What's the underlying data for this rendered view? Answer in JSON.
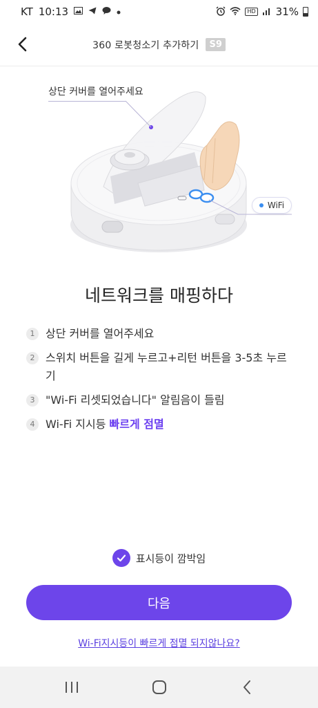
{
  "status_bar": {
    "carrier": "KT",
    "time": "10:13",
    "left_icons": [
      "gallery-icon",
      "telegram-icon",
      "kakao-icon",
      "dot-icon"
    ],
    "right_icons": [
      "alarm-icon",
      "wifi-icon",
      "hd-icon",
      "signal-icon"
    ],
    "hd_label": "HD",
    "battery": "31%"
  },
  "header": {
    "title": "360 로봇청소기 추가하기",
    "model_badge": "S9",
    "back_icon": "chevron-left-icon"
  },
  "illustration": {
    "callout": "상단 커버를 열어주세요",
    "wifi_label": "WiFi"
  },
  "main": {
    "title": "네트워크를 매핑하다",
    "steps": [
      {
        "num": "1",
        "text": "상단 커버를 열어주세요"
      },
      {
        "num": "2",
        "text": "스위치 버튼을 길게 누르고+리턴  버튼을 3-5초 누르기"
      },
      {
        "num": "3",
        "text": "\"Wi-Fi 리셋되었습니다\" 알림음이 들림"
      },
      {
        "num": "4",
        "text": "Wi-Fi 지시등 ",
        "highlight": "빠르게 점멸"
      }
    ]
  },
  "confirm": {
    "label": "표시등이 깜박임",
    "checked": true
  },
  "next_button": "다음",
  "help_link": "Wi-Fi지시등이 빠르게 점멸 되지않나요?",
  "colors": {
    "accent": "#6d45ea",
    "link": "#5a3ee0",
    "highlight": "#6b3ff0"
  },
  "nav_bar": {
    "icons": [
      "recent-apps-icon",
      "home-icon",
      "back-icon"
    ]
  }
}
